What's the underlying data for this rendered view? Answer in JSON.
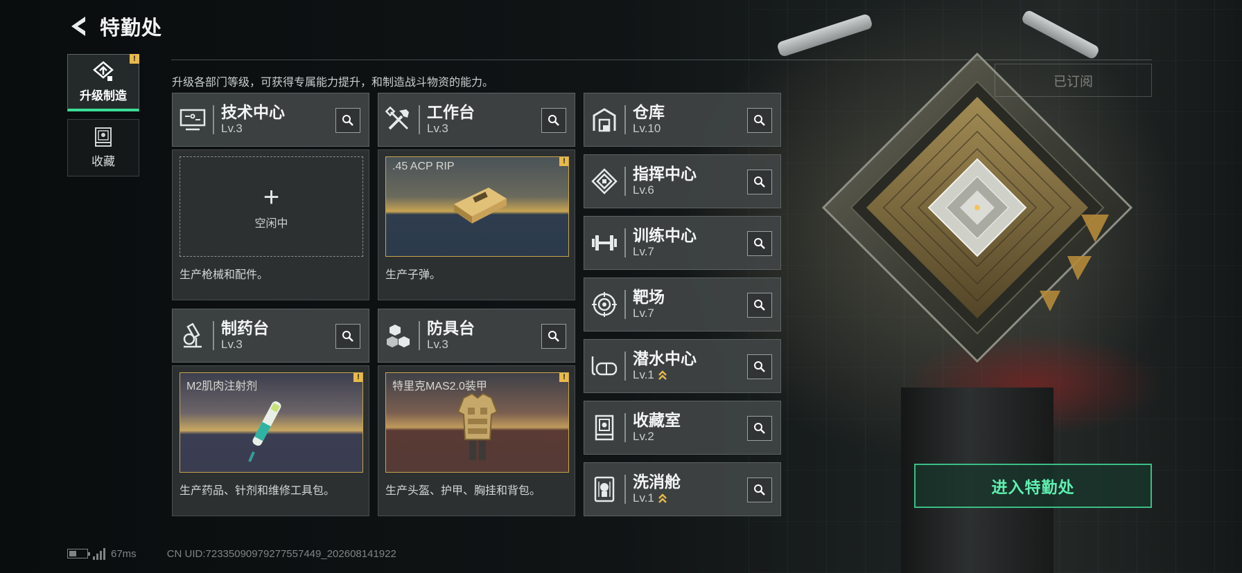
{
  "header": {
    "title": "特勤处"
  },
  "sidebar": {
    "tabs": [
      {
        "label": "升级制造",
        "active": true,
        "has_alert": true,
        "alert_glyph": "!"
      },
      {
        "label": "收藏",
        "active": false
      }
    ]
  },
  "description": "升级各部门等级，可获得专属能力提升，和制造战斗物资的能力。",
  "subscribed_label": "已订阅",
  "stations": [
    {
      "name": "技术中心",
      "level": "Lv.3",
      "icon": "monitor-icon",
      "slot": {
        "state": "idle",
        "plus": "+",
        "label": "空闲中"
      },
      "desc": "生产枪械和配件。"
    },
    {
      "name": "工作台",
      "level": "Lv.3",
      "icon": "tools-icon",
      "slot": {
        "state": "item",
        "item_name": ".45 ACP RIP",
        "alert": "!"
      },
      "desc": "生产子弹。"
    },
    {
      "name": "制药台",
      "level": "Lv.3",
      "icon": "microscope-icon",
      "slot": {
        "state": "item",
        "item_name": "M2肌肉注射剂",
        "alert": "!"
      },
      "desc": "生产药品、针剂和维修工具包。"
    },
    {
      "name": "防具台",
      "level": "Lv.3",
      "icon": "cubes-icon",
      "slot": {
        "state": "item",
        "item_name": "特里克MAS2.0装甲",
        "alert": "!"
      },
      "desc": "生产头盔、护甲、胸挂和背包。"
    }
  ],
  "facilities": [
    {
      "name": "仓库",
      "level": "Lv.10",
      "icon": "storage-icon",
      "upgradable": false
    },
    {
      "name": "指挥中心",
      "level": "Lv.6",
      "icon": "command-icon",
      "upgradable": false
    },
    {
      "name": "训练中心",
      "level": "Lv.7",
      "icon": "dumbbell-icon",
      "upgradable": false
    },
    {
      "name": "靶场",
      "level": "Lv.7",
      "icon": "target-icon",
      "upgradable": false
    },
    {
      "name": "潜水中心",
      "level": "Lv.1",
      "icon": "diving-mask-icon",
      "upgradable": true
    },
    {
      "name": "收藏室",
      "level": "Lv.2",
      "icon": "display-case-icon",
      "upgradable": false
    },
    {
      "name": "洗消舱",
      "level": "Lv.1",
      "icon": "decontamination-icon",
      "upgradable": true
    }
  ],
  "enter_button": "进入特勤处",
  "footer": {
    "ping": "67ms",
    "uid": "CN UID:72335090979277557449_202608141922",
    "battery_fraction": 0.4
  },
  "colors": {
    "accent": "#3ddc97",
    "alert": "#e9b94a",
    "item_border": "#c9a64e"
  }
}
